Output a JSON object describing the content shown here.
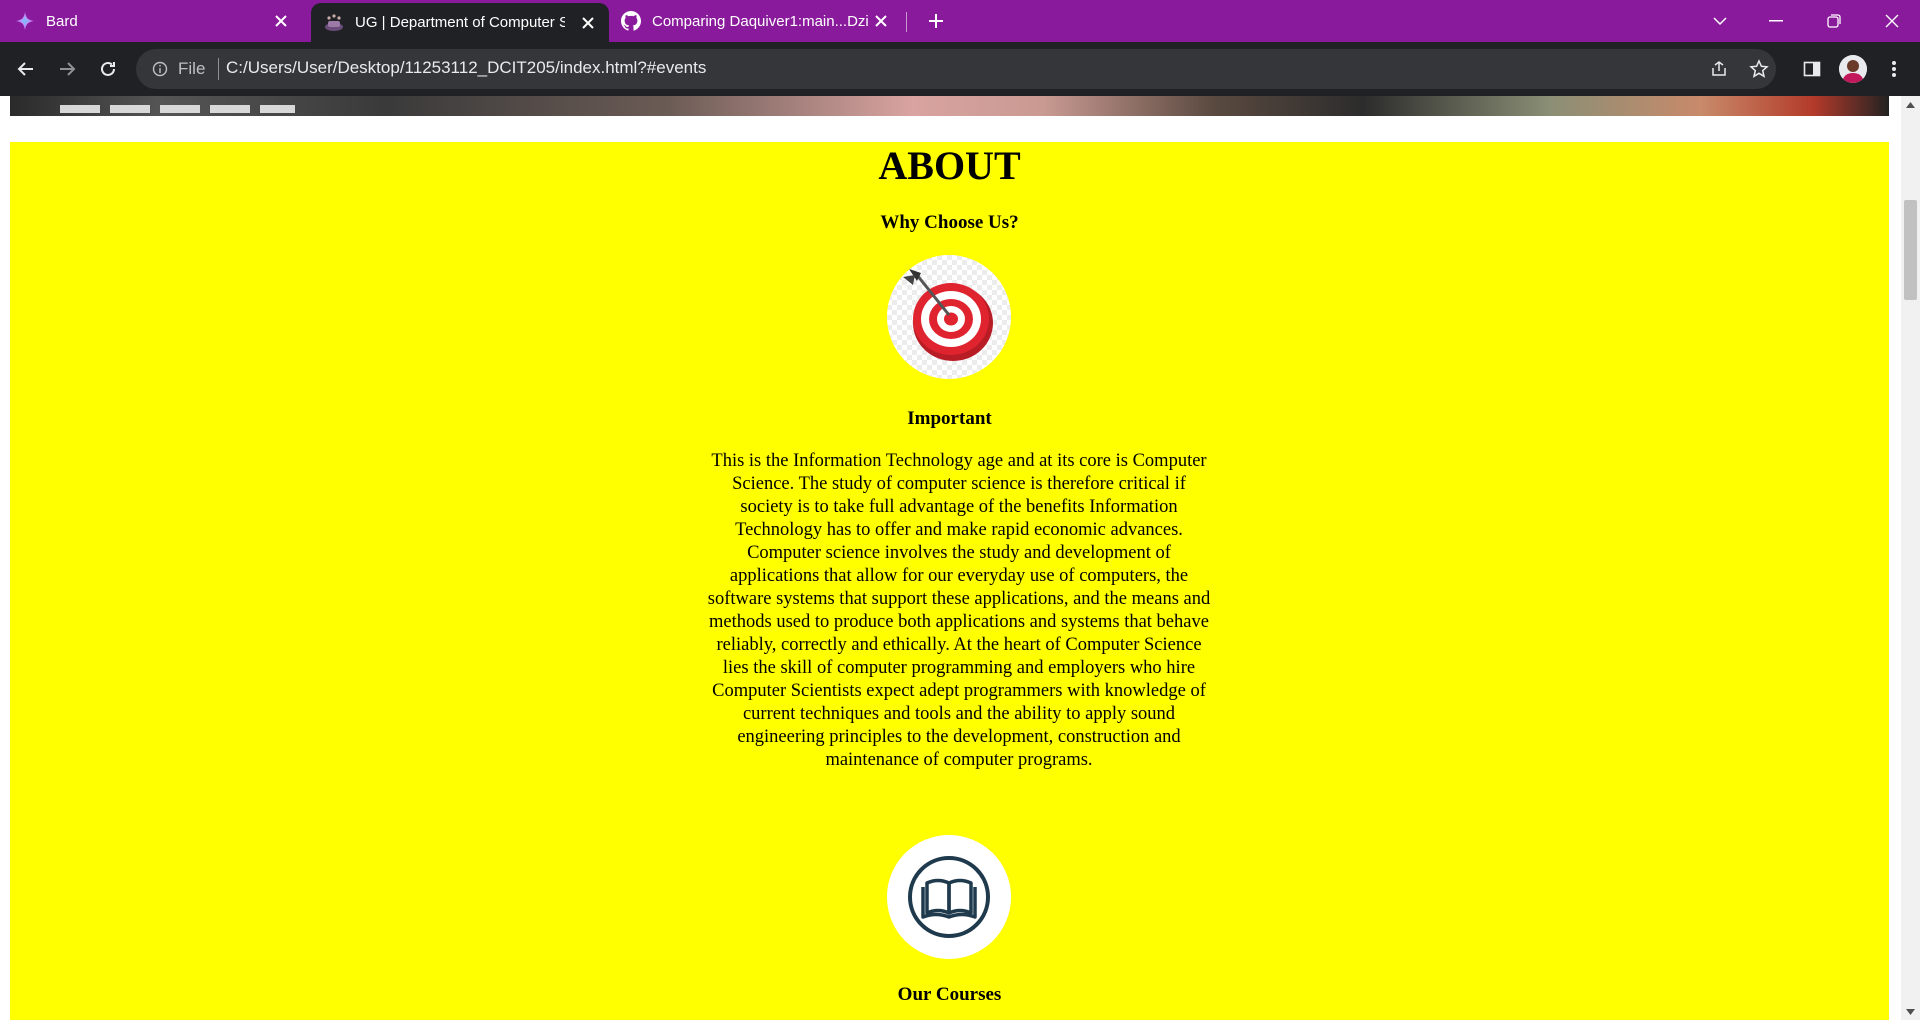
{
  "tabs": [
    {
      "title": "Bard",
      "icon": "bard-sparkle-icon",
      "active": false
    },
    {
      "title": "UG | Department of Computer Science",
      "icon": "ug-crest-icon",
      "active": true
    },
    {
      "title": "Comparing Daquiver1:main...Dzi",
      "icon": "github-icon",
      "active": false
    }
  ],
  "toolbar": {
    "scheme_label": "File",
    "url": "C:/Users/User/Desktop/11253112_DCIT205/index.html?#events"
  },
  "page": {
    "about_heading": "ABOUT",
    "why_heading": "Why Choose Us?",
    "important_heading": "Important",
    "important_text": "This is the Information Technology age and at its core is Computer Science. The study of computer science is therefore critical if society is to take full advantage of the benefits Information Technology has to offer and make rapid economic advances. Computer science involves the study and development of applications that allow for our everyday use of computers, the software systems that support these applications, and the means and methods used to produce both applications and systems that behave reliably, correctly and ethically. At the heart of Computer Science lies the skill of computer programming and employers who hire Computer Scientists expect adept programmers with knowledge of current techniques and tools and the ability to apply sound engineering principles to the development, construction and maintenance of computer programs.",
    "courses_heading": "Our Courses",
    "section_color": "#ffff00"
  },
  "colors": {
    "tabstrip": "#8a1a9c",
    "toolbar": "#202124",
    "omnibox": "#35363a"
  }
}
